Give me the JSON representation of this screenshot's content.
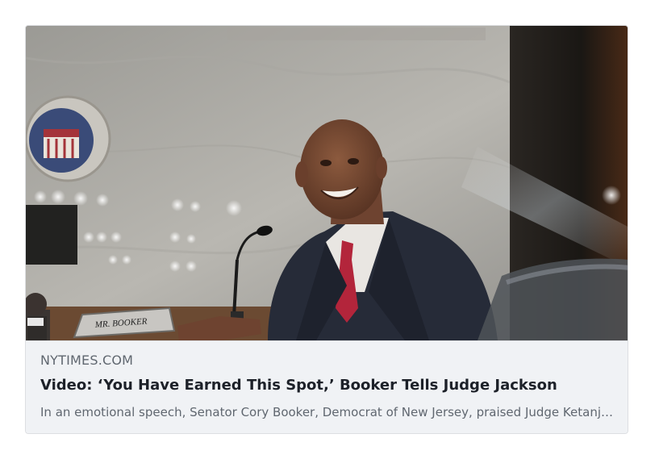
{
  "link_preview": {
    "image_alt": "Senator Cory Booker smiling at a microphone during a hearing",
    "nameplate_text": "MR. BOOKER",
    "domain": "NYTIMES.COM",
    "headline": "Video: ‘You Have Earned This Spot,’ Booker Tells Judge Jackson",
    "description": "In an emotional speech, Senator Cory Booker, Democrat of New Jersey, praised Judge Ketanji Brown Jackson"
  },
  "colors": {
    "card_background": "#f0f2f5",
    "card_border": "#dddfe2",
    "domain_text": "#606770",
    "headline_text": "#1d2129",
    "description_text": "#606770"
  }
}
